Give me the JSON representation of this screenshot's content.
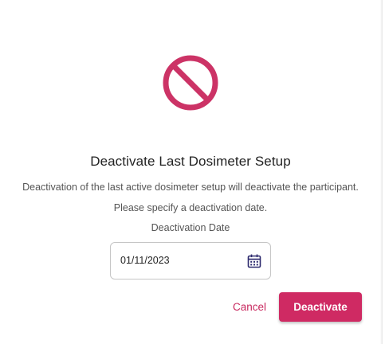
{
  "dialog": {
    "title": "Deactivate Last Dosimeter Setup",
    "message_line1": "Deactivation of the last active dosimeter setup will deactivate the participant.",
    "message_line2": "Please specify a deactivation date.",
    "date_label": "Deactivation Date",
    "date_value": "01/11/2023",
    "cancel_label": "Cancel",
    "confirm_label": "Deactivate"
  },
  "icons": {
    "warning": "prohibited-icon",
    "calendar": "calendar-icon"
  },
  "colors": {
    "accent": "#cf2a63",
    "prohibited_icon": "#cc3366",
    "calendar_icon": "#2d2a6e"
  }
}
